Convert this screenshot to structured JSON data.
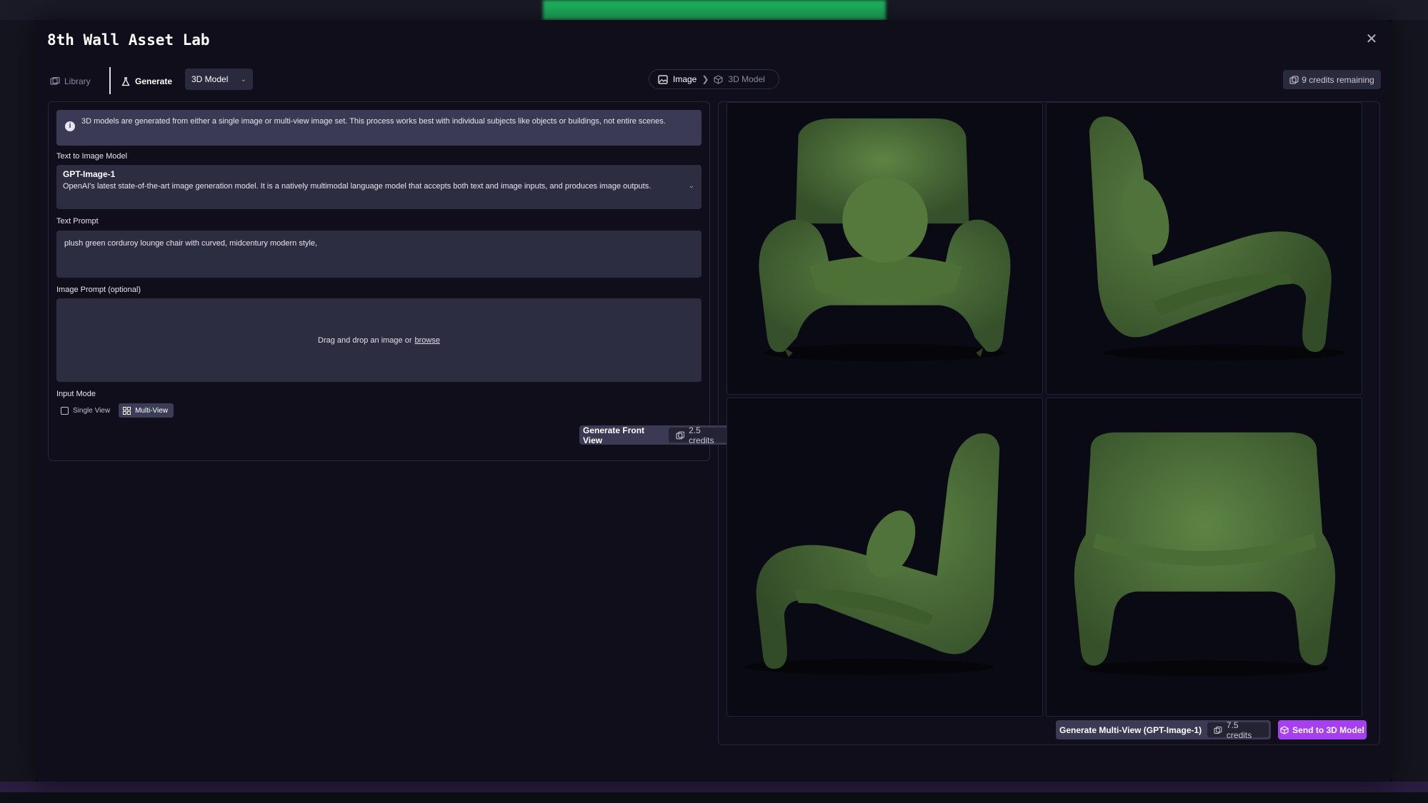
{
  "app": {
    "title": "8th Wall Asset Lab"
  },
  "toolbar": {
    "library_label": "Library",
    "generate_label": "Generate",
    "model_type": "3D Model",
    "breadcrumb": [
      "Image",
      "3D Model"
    ],
    "credits": "9 credits remaining"
  },
  "info": {
    "text": "3D models are generated from either a single image or multi-view image set. This process works best with individual subjects like objects or buildings, not entire scenes."
  },
  "form": {
    "model_label": "Text to Image Model",
    "model_name": "GPT-Image-1",
    "model_desc": "OpenAI's latest state-of-the-art image generation model. It is a natively multimodal language model that accepts both text and image inputs, and produces image outputs.",
    "prompt_label": "Text Prompt",
    "prompt_value": "plush green corduroy lounge chair with curved, midcentury modern style,",
    "image_prompt_label": "Image Prompt (optional)",
    "drop_text": "Drag and drop an image or",
    "browse_text": "browse",
    "input_mode_label": "Input Mode",
    "mode_single": "Single View",
    "mode_multi": "Multi-View",
    "mode_selected": "Multi-View",
    "generate_front_label": "Generate Front View",
    "generate_front_cost": "2.5 credits"
  },
  "preview": {
    "views": [
      "front",
      "side-right",
      "side-left",
      "back"
    ],
    "chair_color": "#4a6b34",
    "generate_multi_label": "Generate Multi-View (GPT-Image-1)",
    "generate_multi_cost": "7.5 credits",
    "send_label": "Send to 3D Model"
  },
  "colors": {
    "accent": "#a53ff0",
    "panel": "#2d2d42",
    "background": "#0f0e1a"
  }
}
